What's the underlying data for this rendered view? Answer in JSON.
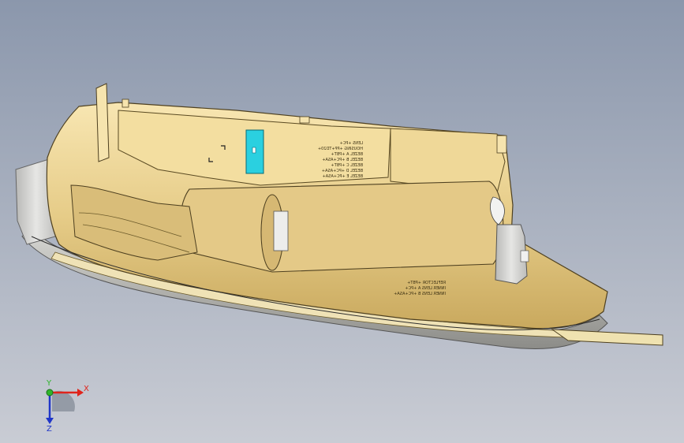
{
  "viewport": {
    "background_top": "#8b97ac",
    "background_bottom": "#c9ccd4"
  },
  "model": {
    "body_color": "#e8cf8c",
    "highlight_color": "#f6e4ae",
    "shade_color": "#b89a52",
    "gray_part_color": "#c8c8c6",
    "selected_face_color": "#2ad0e0",
    "engraved_text_1": [
      "LENS +PC+",
      "HOUSING +PP+TD20+",
      "BEZEL A +PBT+",
      "BEZEL B +PC+ASA+",
      "BEZEL C +PBT+",
      "BEZEL D +PC+ASA+",
      "BEZEL E +PC+ASA+"
    ],
    "engraved_text_2": [
      "REFLECTOR +PBT+",
      "INNER LENS A +PC+",
      "INNER LENS B +PC+ASA+"
    ]
  },
  "triad": {
    "x_label": "X",
    "y_label": "Y",
    "z_label": "Z",
    "x_color": "#e0241c",
    "y_color": "#2fb52b",
    "z_color": "#2036c8"
  }
}
